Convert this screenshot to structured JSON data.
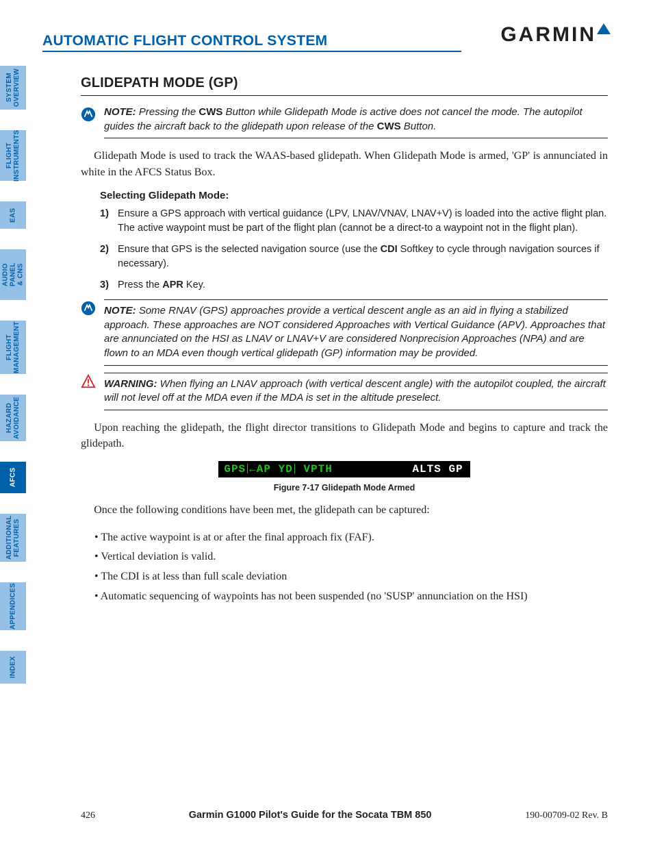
{
  "header": {
    "title": "AUTOMATIC FLIGHT CONTROL SYSTEM",
    "logo_text": "GARMIN",
    "logo_r": "®"
  },
  "tabs": [
    {
      "label": "SYSTEM\nOVERVIEW",
      "active": false
    },
    {
      "label": "FLIGHT\nINSTRUMENTS",
      "active": false
    },
    {
      "label": "EAS",
      "active": false
    },
    {
      "label": "AUDIO PANEL\n& CNS",
      "active": false
    },
    {
      "label": "FLIGHT\nMANAGEMENT",
      "active": false
    },
    {
      "label": "HAZARD\nAVOIDANCE",
      "active": false
    },
    {
      "label": "AFCS",
      "active": true
    },
    {
      "label": "ADDITIONAL\nFEATURES",
      "active": false
    },
    {
      "label": "APPENDICES",
      "active": false
    },
    {
      "label": "INDEX",
      "active": false
    }
  ],
  "section": {
    "heading": "GLIDEPATH MODE (GP)"
  },
  "note1": {
    "lead": "NOTE:",
    "t1": " Pressing the ",
    "b1": "CWS",
    "t2": " Button while Glidepath Mode is active does not cancel the mode.  The autopilot guides the aircraft back to the glidepath upon release of the ",
    "b2": "CWS",
    "t3": " Button."
  },
  "para1": "Glidepath Mode is used to track the WAAS-based glidepath.  When Glidepath Mode is armed, 'GP' is annunciated in white in the AFCS Status Box.",
  "subhead": "Selecting Glidepath Mode:",
  "steps": [
    {
      "n": "1)",
      "text": "Ensure a GPS approach with vertical guidance (LPV, LNAV/VNAV, LNAV+V) is loaded into the active flight plan.  The active waypoint must be part of the flight plan (cannot be a direct-to a waypoint not in the flight plan)."
    },
    {
      "n": "2)",
      "pre": "Ensure that GPS is the selected navigation source (use the ",
      "btn": "CDI",
      "post": " Softkey to cycle through navigation sources if necessary)."
    },
    {
      "n": "3)",
      "pre": "Press the ",
      "btn": "APR",
      "post": " Key."
    }
  ],
  "note2": {
    "lead": "NOTE:",
    "text": " Some RNAV (GPS) approaches provide a vertical descent angle as an aid in flying a stabilized approach.  These approaches are NOT considered Approaches with Vertical Guidance (APV).  Approaches that are annunciated on the HSI as LNAV or LNAV+V are considered Nonprecision Approaches (NPA) and are flown to an MDA even though vertical glidepath (GP) information may be provided."
  },
  "warn": {
    "lead": "WARNING:",
    "text": " When flying an LNAV approach (with vertical descent angle) with the autopilot coupled, the aircraft will not level off at the MDA even if the MDA is set in the altitude preselect."
  },
  "para2": "Upon reaching the glidepath, the flight director transitions to Glidepath Mode and begins to capture and track the glidepath.",
  "afcs": {
    "gps": "GPS",
    "arrow": "←",
    "ap": "AP",
    "yd": "YD",
    "vpth": "VPTH",
    "alts": "ALTS",
    "gp": "GP"
  },
  "figcap": "Figure 7-17  Glidepath Mode Armed",
  "para3": "Once the following conditions have been met, the glidepath can be captured:",
  "bullets": [
    "The active waypoint is at or after the final approach fix (FAF).",
    "Vertical deviation is valid.",
    "The CDI is at less than full scale deviation",
    "Automatic sequencing of waypoints has not been suspended (no 'SUSP' annunciation on the HSI)"
  ],
  "footer": {
    "page": "426",
    "mid": "Garmin G1000 Pilot's Guide for the Socata TBM 850",
    "rev": "190-00709-02  Rev. B"
  }
}
